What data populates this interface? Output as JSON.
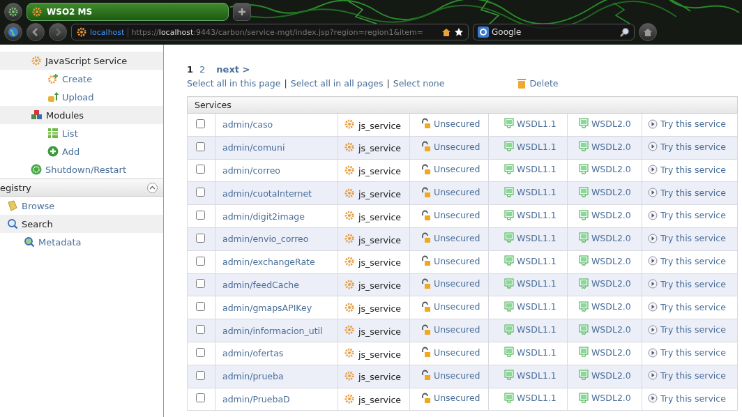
{
  "browser": {
    "tab_title": "WSO2 MS",
    "site_label": "localhost",
    "url_scheme": "https://",
    "url_host": "localhost",
    "url_rest": ":9443/carbon/service-mgt/index.jsp?region=region1&item=",
    "search_engine": "Google"
  },
  "sidebar": {
    "items": [
      {
        "label": "JavaScript Service",
        "kind": "js",
        "children": [
          {
            "label": "Create",
            "kind": "create"
          },
          {
            "label": "Upload",
            "kind": "upload"
          }
        ]
      },
      {
        "label": "Modules",
        "kind": "modules",
        "children": [
          {
            "label": "List",
            "kind": "list"
          },
          {
            "label": "Add",
            "kind": "add"
          }
        ]
      },
      {
        "label": "Shutdown/Restart",
        "kind": "shutdown"
      }
    ],
    "sections": [
      {
        "title": "egistry",
        "expanded": true,
        "items": [
          {
            "label": "Browse",
            "kind": "browse"
          },
          {
            "label": "Search",
            "kind": "search",
            "children": [
              {
                "label": "Metadata",
                "kind": "metadata"
              }
            ]
          }
        ]
      }
    ]
  },
  "pagination": {
    "pages": [
      {
        "label": "1",
        "selected": true
      },
      {
        "label": "2",
        "selected": false
      }
    ],
    "next": "next >"
  },
  "select_links": [
    "Select all in this page",
    "Select all in all pages",
    "Select none"
  ],
  "select_separator": "|",
  "delete": "Delete",
  "table": {
    "title": "Services",
    "rows": [
      {
        "checked": false,
        "name": "admin/caso",
        "type": "js_service",
        "security": "Unsecured",
        "wsdl1": "WSDL1.1",
        "wsdl2": "WSDL2.0",
        "try": "Try this service"
      },
      {
        "checked": false,
        "name": "admin/comuni",
        "type": "js_service",
        "security": "Unsecured",
        "wsdl1": "WSDL1.1",
        "wsdl2": "WSDL2.0",
        "try": "Try this service"
      },
      {
        "checked": false,
        "name": "admin/correo",
        "type": "js_service",
        "security": "Unsecured",
        "wsdl1": "WSDL1.1",
        "wsdl2": "WSDL2.0",
        "try": "Try this service"
      },
      {
        "checked": false,
        "name": "admin/cuotaInternet",
        "type": "js_service",
        "security": "Unsecured",
        "wsdl1": "WSDL1.1",
        "wsdl2": "WSDL2.0",
        "try": "Try this service"
      },
      {
        "checked": false,
        "name": "admin/digit2image",
        "type": "js_service",
        "security": "Unsecured",
        "wsdl1": "WSDL1.1",
        "wsdl2": "WSDL2.0",
        "try": "Try this service"
      },
      {
        "checked": false,
        "name": "admin/envio_correo",
        "type": "js_service",
        "security": "Unsecured",
        "wsdl1": "WSDL1.1",
        "wsdl2": "WSDL2.0",
        "try": "Try this service"
      },
      {
        "checked": false,
        "name": "admin/exchangeRate",
        "type": "js_service",
        "security": "Unsecured",
        "wsdl1": "WSDL1.1",
        "wsdl2": "WSDL2.0",
        "try": "Try this service"
      },
      {
        "checked": false,
        "name": "admin/feedCache",
        "type": "js_service",
        "security": "Unsecured",
        "wsdl1": "WSDL1.1",
        "wsdl2": "WSDL2.0",
        "try": "Try this service"
      },
      {
        "checked": false,
        "name": "admin/gmapsAPIKey",
        "type": "js_service",
        "security": "Unsecured",
        "wsdl1": "WSDL1.1",
        "wsdl2": "WSDL2.0",
        "try": "Try this service"
      },
      {
        "checked": false,
        "name": "admin/informacion_util",
        "type": "js_service",
        "security": "Unsecured",
        "wsdl1": "WSDL1.1",
        "wsdl2": "WSDL2.0",
        "try": "Try this service"
      },
      {
        "checked": false,
        "name": "admin/ofertas",
        "type": "js_service",
        "security": "Unsecured",
        "wsdl1": "WSDL1.1",
        "wsdl2": "WSDL2.0",
        "try": "Try this service"
      },
      {
        "checked": false,
        "name": "admin/prueba",
        "type": "js_service",
        "security": "Unsecured",
        "wsdl1": "WSDL1.1",
        "wsdl2": "WSDL2.0",
        "try": "Try this service"
      },
      {
        "checked": false,
        "name": "admin/PruebaD",
        "type": "js_service",
        "security": "Unsecured",
        "wsdl1": "WSDL1.1",
        "wsdl2": "WSDL2.0",
        "try": "Try this service"
      }
    ]
  }
}
